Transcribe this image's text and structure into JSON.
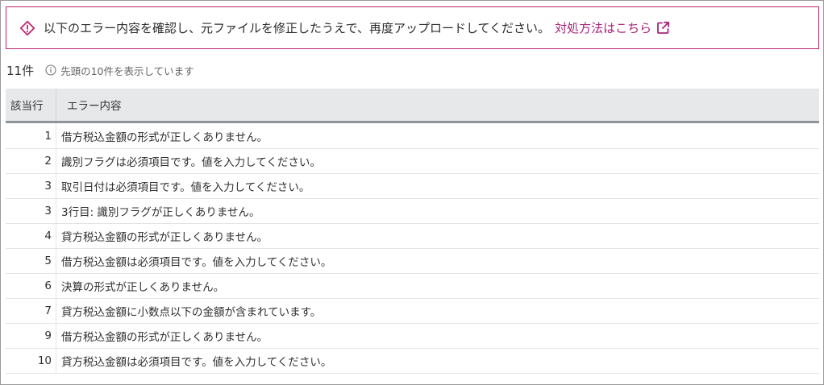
{
  "alert": {
    "icon": "warning-diamond-icon",
    "message": "以下のエラー内容を確認し、元ファイルを修正したうえで、再度アップロードしてください。",
    "link_label": "対処方法はこちら",
    "link_icon": "external-link-icon",
    "border_color": "#c0266a",
    "link_color": "#a8237a"
  },
  "summary": {
    "count": "11件",
    "info_icon": "info-icon",
    "note": "先頭の10件を表示しています"
  },
  "table": {
    "columns": [
      "該当行",
      "エラー内容"
    ],
    "rows": [
      {
        "line": "1",
        "message": "借方税込金額の形式が正しくありません。"
      },
      {
        "line": "2",
        "message": "識別フラグは必須項目です。値を入力してください。"
      },
      {
        "line": "3",
        "message": "取引日付は必須項目です。値を入力してください。"
      },
      {
        "line": "3",
        "message": "3行目: 識別フラグが正しくありません。"
      },
      {
        "line": "4",
        "message": "貸方税込金額の形式が正しくありません。"
      },
      {
        "line": "5",
        "message": "借方税込金額は必須項目です。値を入力してください。"
      },
      {
        "line": "6",
        "message": "決算の形式が正しくありません。"
      },
      {
        "line": "7",
        "message": "貸方税込金額に小数点以下の金額が含まれています。"
      },
      {
        "line": "9",
        "message": "借方税込金額の形式が正しくありません。"
      },
      {
        "line": "10",
        "message": "貸方税込金額は必須項目です。値を入力してください。"
      }
    ]
  }
}
